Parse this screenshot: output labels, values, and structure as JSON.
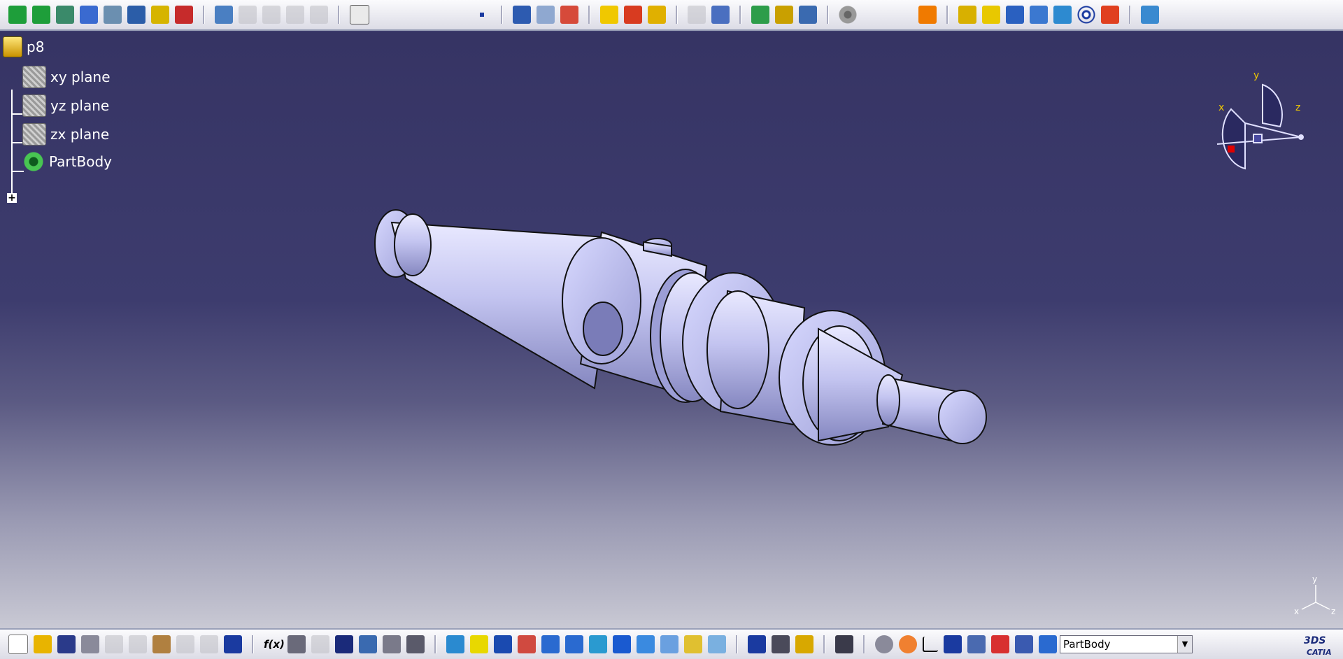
{
  "tree": {
    "root_label": "p8",
    "items": [
      {
        "label": "xy plane"
      },
      {
        "label": "yz plane"
      },
      {
        "label": "zx plane"
      },
      {
        "label": "PartBody"
      }
    ]
  },
  "compass": {
    "x_label": "x",
    "y_label": "y",
    "z_label": "z"
  },
  "axis_triad": {
    "x_label": "x",
    "y_label": "y",
    "z_label": "z"
  },
  "toolbar_bottom": {
    "combo_value": "PartBody"
  },
  "logo_text": "CATIA",
  "colors": {
    "background_top": "#363464",
    "background_bottom": "#c9c9d4",
    "part_fill": "#c3c4f0",
    "accent_yellow": "#f0c800"
  }
}
